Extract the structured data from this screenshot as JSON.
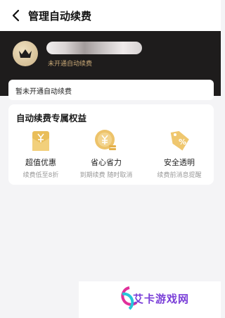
{
  "header": {
    "title": "管理自动续费"
  },
  "profile": {
    "status": "未开通自动续费"
  },
  "notice": {
    "text": "暂未开通自动续费"
  },
  "benefits": {
    "title": "自动续费专属权益",
    "items": [
      {
        "name": "超值优惠",
        "sub": "续费低至8折",
        "icon": "discount-envelope-icon"
      },
      {
        "name": "省心省力",
        "sub": "到期续费 随时取消",
        "icon": "yen-coin-icon"
      },
      {
        "name": "安全透明",
        "sub": "续费前消息提醒",
        "icon": "percent-tag-icon"
      }
    ]
  },
  "watermark": {
    "text": "艾卡游戏网"
  },
  "colors": {
    "gold": "#c9a977",
    "dark": "#1e1c1c",
    "accent": "#e4b04a"
  }
}
